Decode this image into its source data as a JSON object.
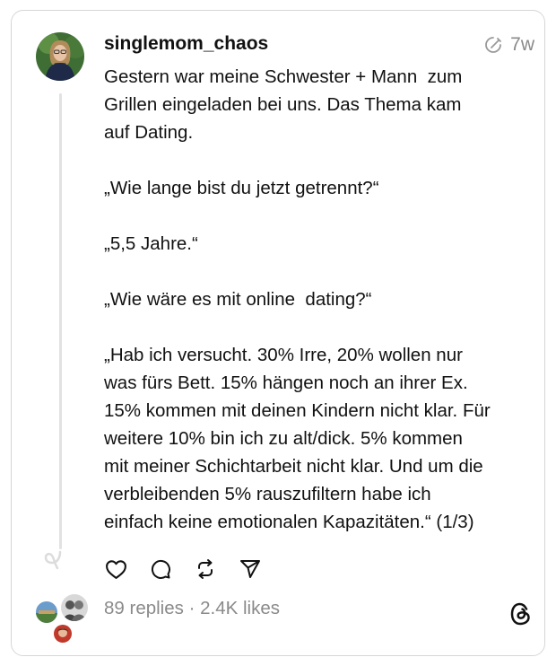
{
  "post": {
    "username": "singlemom_chaos",
    "timestamp": "7w",
    "text": "Gestern war meine Schwester + Mann  zum\nGrillen eingeladen bei uns. Das Thema kam\nauf Dating.\n\n„Wie lange bist du jetzt getrennt?“\n\n„5,5 Jahre.“\n\n„Wie wäre es mit online  dating?“\n\n„Hab ich versucht. 30% Irre, 20% wollen nur\nwas fürs Bett. 15% hängen noch an ihrer Ex.\n15% kommen mit deinen Kindern nicht klar. Für\nweitere 10% bin ich zu alt/dick. 5% kommen\nmit meiner Schichtarbeit nicht klar. Und um die\nverbleibenden 5% rauszufiltern habe ich\neinfach keine emotionalen Kapazitäten.“ (1/3)"
  },
  "stats": {
    "summary": "89 replies · 2.4K likes"
  },
  "icons": {
    "edited": "edited-pencil-circle-icon",
    "like": "heart-icon",
    "reply": "comment-bubble-icon",
    "repost": "repost-icon",
    "share": "share-send-icon",
    "brand": "threads-logo-icon"
  },
  "colors": {
    "muted": "#8a8a8a",
    "text": "#111111",
    "border": "#d6d6d6"
  }
}
